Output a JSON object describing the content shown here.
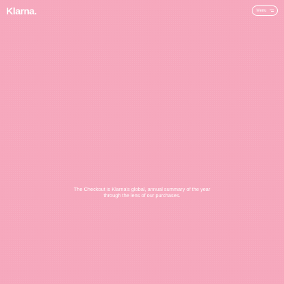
{
  "header": {
    "logo_text": "Klarna.",
    "menu_label": "Menu",
    "menu_icon": "hamburger-icon"
  },
  "hero": {
    "tagline_line1": "The Checkout is Klarna’s global, annual summary of the year",
    "tagline_line2": "through the lens of our purchases."
  },
  "colors": {
    "background": "#f6a8bd",
    "text": "#ffffff"
  }
}
